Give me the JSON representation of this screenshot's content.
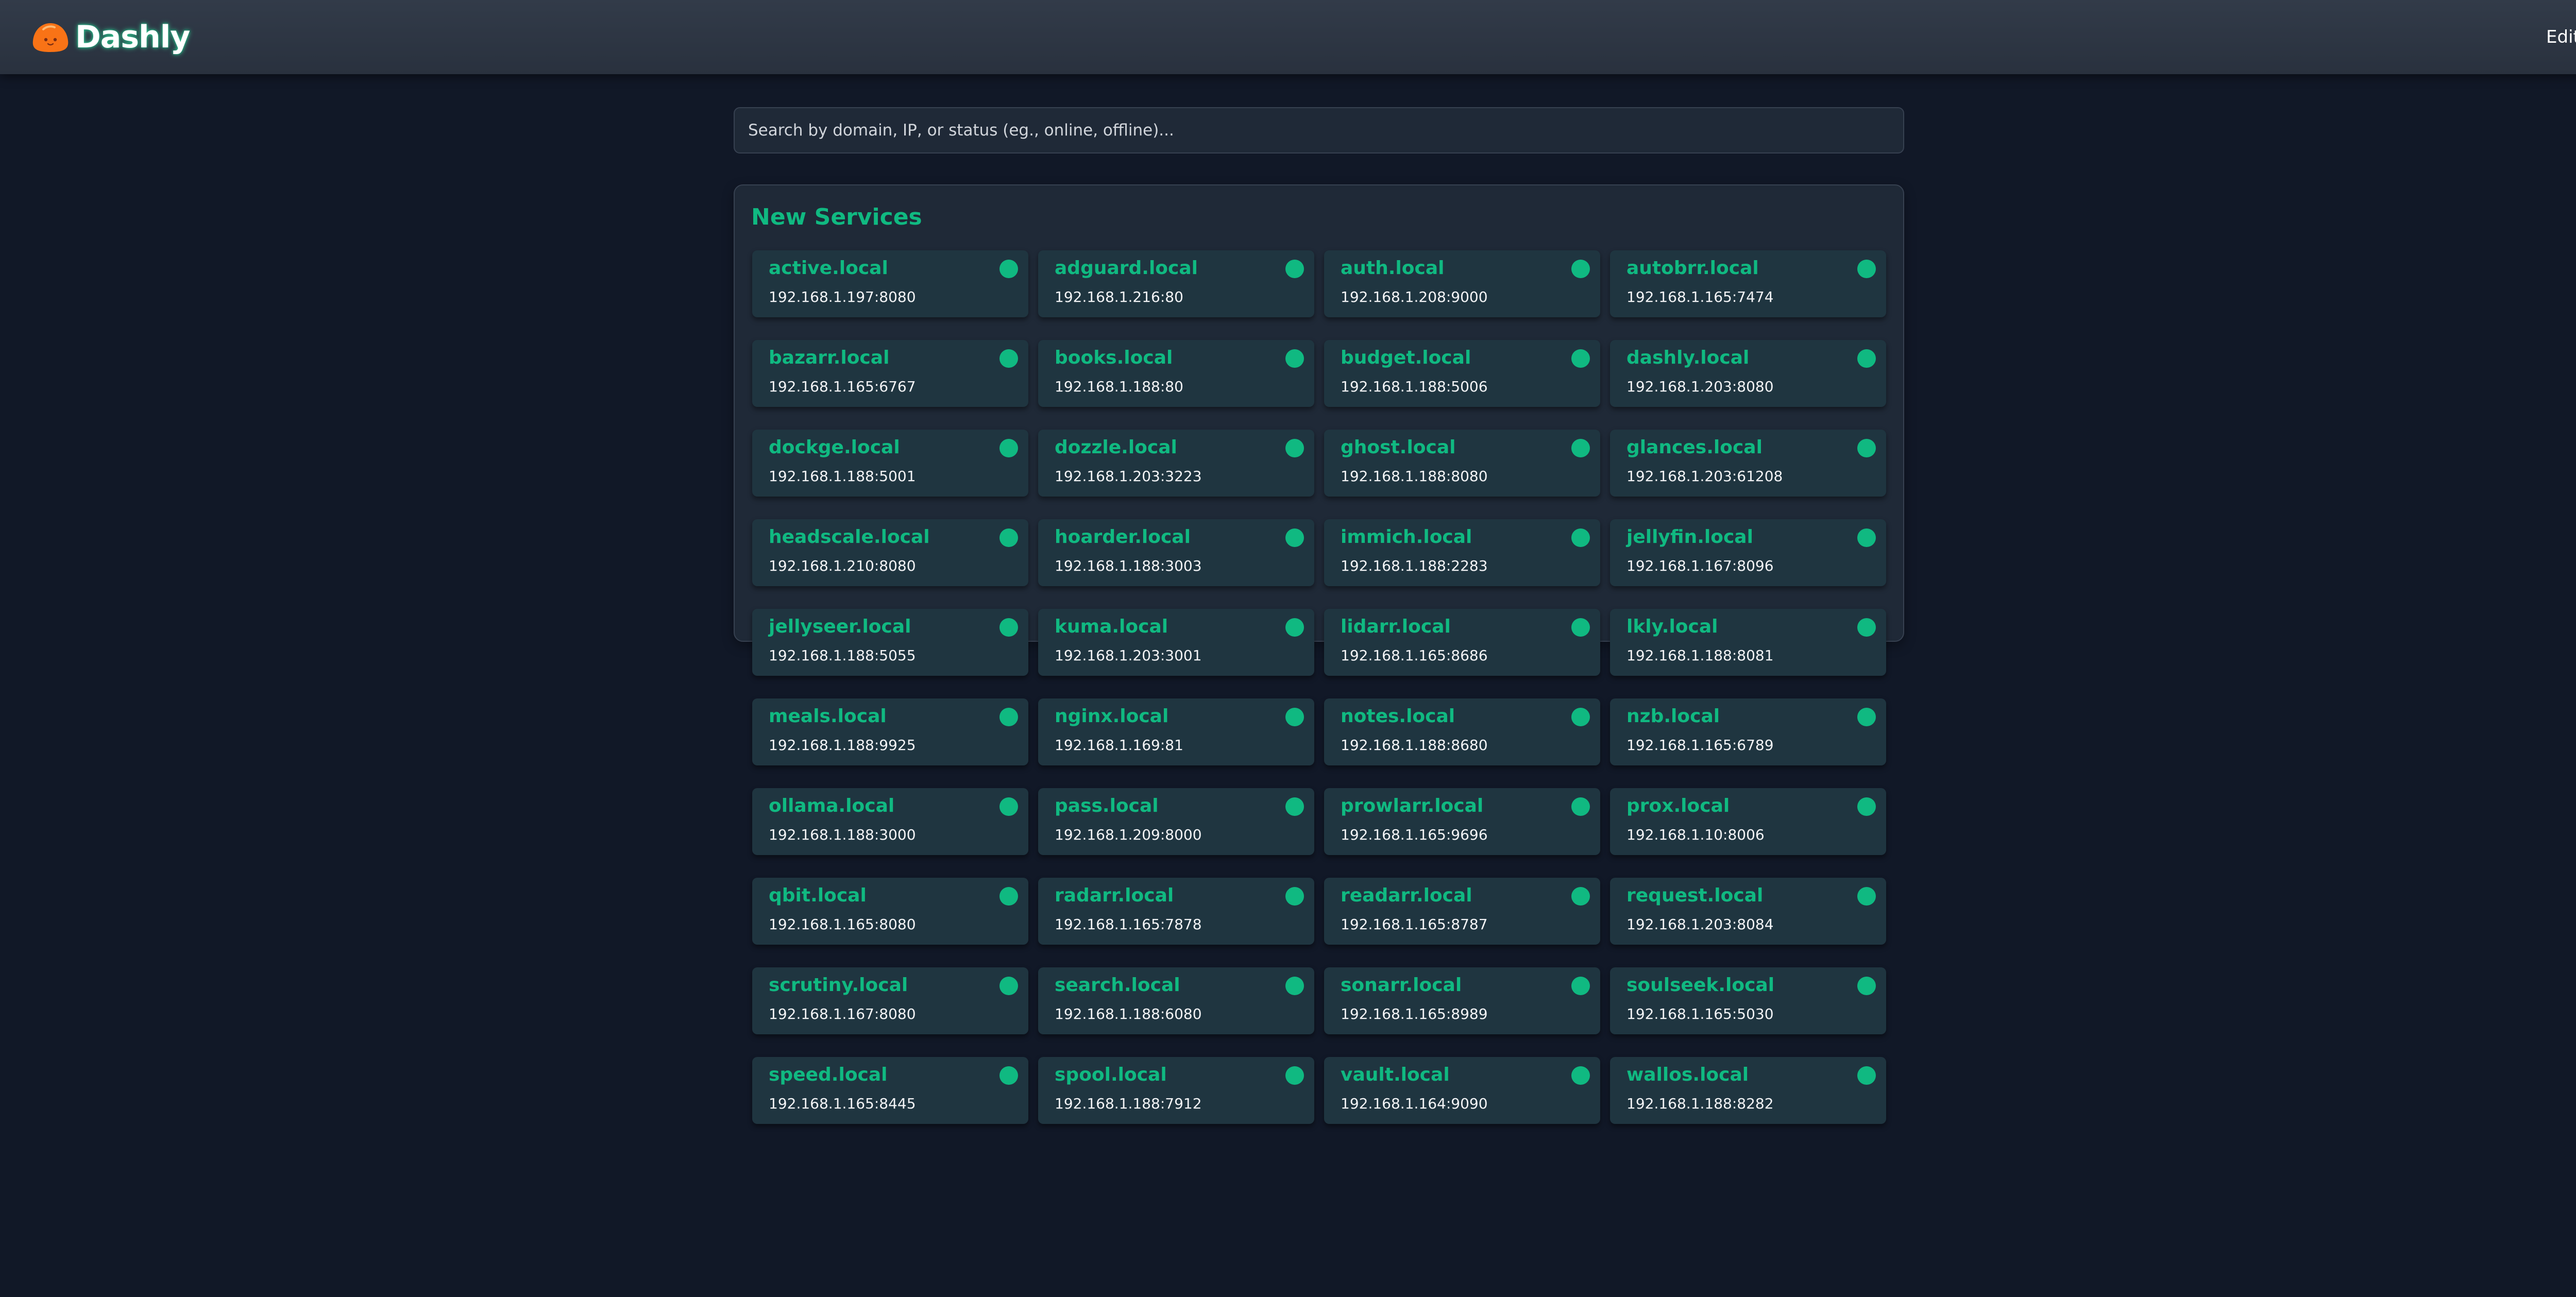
{
  "header": {
    "app_title": "Dashly",
    "logo_icon": "orange-blob-logo-icon",
    "edit_label": "Edit"
  },
  "search": {
    "placeholder": "Search by domain, IP, or status (eg., online, offline)...",
    "value": ""
  },
  "colors": {
    "background": "#111827",
    "header": "#2d3543",
    "panel": "#1f2937",
    "card": "#1f3540",
    "accent": "#10b981",
    "online_status": "#10b981",
    "logo": "#f97316"
  },
  "section": {
    "title": "New Services",
    "services": [
      {
        "domain": "active.local",
        "ip": "192.168.1.197:8080",
        "status": "online"
      },
      {
        "domain": "adguard.local",
        "ip": "192.168.1.216:80",
        "status": "online"
      },
      {
        "domain": "auth.local",
        "ip": "192.168.1.208:9000",
        "status": "online"
      },
      {
        "domain": "autobrr.local",
        "ip": "192.168.1.165:7474",
        "status": "online"
      },
      {
        "domain": "bazarr.local",
        "ip": "192.168.1.165:6767",
        "status": "online"
      },
      {
        "domain": "books.local",
        "ip": "192.168.1.188:80",
        "status": "online"
      },
      {
        "domain": "budget.local",
        "ip": "192.168.1.188:5006",
        "status": "online"
      },
      {
        "domain": "dashly.local",
        "ip": "192.168.1.203:8080",
        "status": "online"
      },
      {
        "domain": "dockge.local",
        "ip": "192.168.1.188:5001",
        "status": "online"
      },
      {
        "domain": "dozzle.local",
        "ip": "192.168.1.203:3223",
        "status": "online"
      },
      {
        "domain": "ghost.local",
        "ip": "192.168.1.188:8080",
        "status": "online"
      },
      {
        "domain": "glances.local",
        "ip": "192.168.1.203:61208",
        "status": "online"
      },
      {
        "domain": "headscale.local",
        "ip": "192.168.1.210:8080",
        "status": "online"
      },
      {
        "domain": "hoarder.local",
        "ip": "192.168.1.188:3003",
        "status": "online"
      },
      {
        "domain": "immich.local",
        "ip": "192.168.1.188:2283",
        "status": "online"
      },
      {
        "domain": "jellyfin.local",
        "ip": "192.168.1.167:8096",
        "status": "online"
      },
      {
        "domain": "jellyseer.local",
        "ip": "192.168.1.188:5055",
        "status": "online"
      },
      {
        "domain": "kuma.local",
        "ip": "192.168.1.203:3001",
        "status": "online"
      },
      {
        "domain": "lidarr.local",
        "ip": "192.168.1.165:8686",
        "status": "online"
      },
      {
        "domain": "lkly.local",
        "ip": "192.168.1.188:8081",
        "status": "online"
      },
      {
        "domain": "meals.local",
        "ip": "192.168.1.188:9925",
        "status": "online"
      },
      {
        "domain": "nginx.local",
        "ip": "192.168.1.169:81",
        "status": "online"
      },
      {
        "domain": "notes.local",
        "ip": "192.168.1.188:8680",
        "status": "online"
      },
      {
        "domain": "nzb.local",
        "ip": "192.168.1.165:6789",
        "status": "online"
      },
      {
        "domain": "ollama.local",
        "ip": "192.168.1.188:3000",
        "status": "online"
      },
      {
        "domain": "pass.local",
        "ip": "192.168.1.209:8000",
        "status": "online"
      },
      {
        "domain": "prowlarr.local",
        "ip": "192.168.1.165:9696",
        "status": "online"
      },
      {
        "domain": "prox.local",
        "ip": "192.168.1.10:8006",
        "status": "online"
      },
      {
        "domain": "qbit.local",
        "ip": "192.168.1.165:8080",
        "status": "online"
      },
      {
        "domain": "radarr.local",
        "ip": "192.168.1.165:7878",
        "status": "online"
      },
      {
        "domain": "readarr.local",
        "ip": "192.168.1.165:8787",
        "status": "online"
      },
      {
        "domain": "request.local",
        "ip": "192.168.1.203:8084",
        "status": "online"
      },
      {
        "domain": "scrutiny.local",
        "ip": "192.168.1.167:8080",
        "status": "online"
      },
      {
        "domain": "search.local",
        "ip": "192.168.1.188:6080",
        "status": "online"
      },
      {
        "domain": "sonarr.local",
        "ip": "192.168.1.165:8989",
        "status": "online"
      },
      {
        "domain": "soulseek.local",
        "ip": "192.168.1.165:5030",
        "status": "online"
      },
      {
        "domain": "speed.local",
        "ip": "192.168.1.165:8445",
        "status": "online"
      },
      {
        "domain": "spool.local",
        "ip": "192.168.1.188:7912",
        "status": "online"
      },
      {
        "domain": "vault.local",
        "ip": "192.168.1.164:9090",
        "status": "online"
      },
      {
        "domain": "wallos.local",
        "ip": "192.168.1.188:8282",
        "status": "online"
      }
    ]
  }
}
